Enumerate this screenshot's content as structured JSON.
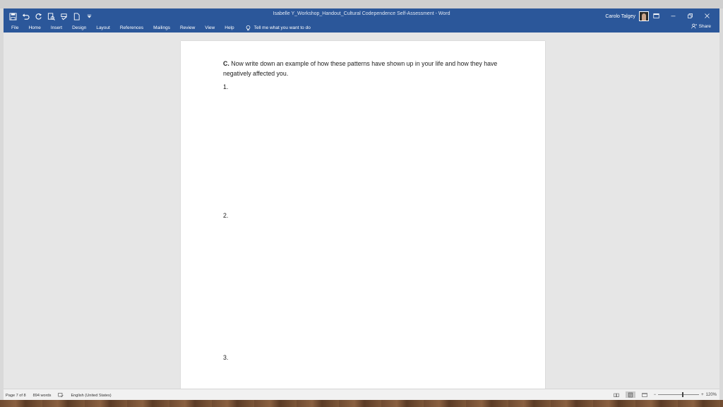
{
  "window": {
    "title": "Isabelle Y_Workshop_Handout_Cultural Codependence Self-Assessment  -  Word",
    "user_name": "Carolo Talgey",
    "share_label": "Share"
  },
  "ribbon": {
    "tabs": [
      "File",
      "Home",
      "Insert",
      "Design",
      "Layout",
      "References",
      "Mailings",
      "Review",
      "View",
      "Help"
    ],
    "tell_me": "Tell me what you want to do"
  },
  "document": {
    "section_label": "C.",
    "prompt_text": " Now write down an example of how these patterns have shown up in your life and how they have negatively affected you.",
    "items": [
      "1.",
      "2.",
      "3."
    ]
  },
  "status": {
    "page": "Page 7 of 8",
    "words": "894 words",
    "language": "English (United States)",
    "zoom": "120%",
    "zoom_minus": "−",
    "zoom_plus": "+"
  },
  "colors": {
    "ribbon": "#2b579a",
    "page": "#ffffff",
    "canvas": "#e6e6e6"
  }
}
